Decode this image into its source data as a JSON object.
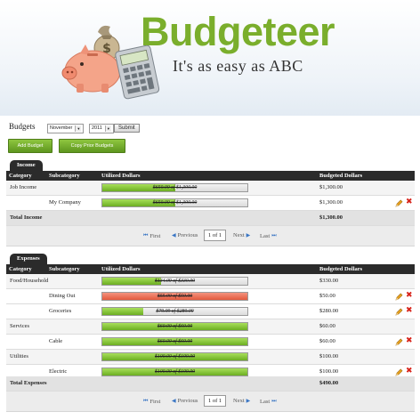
{
  "app": {
    "name": "Budgeteer",
    "tagline": "It's as easy as ABC"
  },
  "controls": {
    "label": "Budgets",
    "month": "November",
    "year": "2011",
    "submit_label": "Submit",
    "add_budget_label": "Add Budget",
    "copy_prior_label": "Copy Prior Budgets"
  },
  "columns": {
    "category": "Category",
    "subcategory": "Subcategory",
    "utilized": "Utilized Dollars",
    "budgeted": "Budgeted Dollars"
  },
  "income": {
    "tab_label": "Income",
    "rows": [
      {
        "category": "Job Income",
        "subcategory": "",
        "bar_text": "$650.00 of $1,300.00",
        "utilized_fraction": 0.5,
        "over": false,
        "budgeted": "$1,300.00",
        "editable": false
      },
      {
        "category": "",
        "subcategory": "My Company",
        "bar_text": "$650.00 of $1,300.00",
        "utilized_fraction": 0.5,
        "over": false,
        "budgeted": "$1,300.00",
        "editable": true
      }
    ],
    "total_label": "Total Income",
    "total_value": "$1,300.00"
  },
  "expenses": {
    "tab_label": "Expenses",
    "rows": [
      {
        "category": "Food/Household",
        "subcategory": "",
        "bar_text": "$134.09 of $330.00",
        "utilized_fraction": 0.406,
        "over": false,
        "budgeted": "$330.00",
        "editable": false
      },
      {
        "category": "",
        "subcategory": "Dining Out",
        "bar_text": "$55.00 of $50.00",
        "utilized_fraction": 1.0,
        "over": true,
        "budgeted": "$50.00",
        "editable": true
      },
      {
        "category": "",
        "subcategory": "Groceries",
        "bar_text": "$79.09 of $280.00",
        "utilized_fraction": 0.282,
        "over": false,
        "budgeted": "$280.00",
        "editable": true
      },
      {
        "category": "Services",
        "subcategory": "",
        "bar_text": "$60.00 of $60.00",
        "utilized_fraction": 1.0,
        "over": false,
        "budgeted": "$60.00",
        "editable": false
      },
      {
        "category": "",
        "subcategory": "Cable",
        "bar_text": "$60.00 of $60.00",
        "utilized_fraction": 1.0,
        "over": false,
        "budgeted": "$60.00",
        "editable": true
      },
      {
        "category": "Utilities",
        "subcategory": "",
        "bar_text": "$100.00 of $100.00",
        "utilized_fraction": 1.0,
        "over": false,
        "budgeted": "$100.00",
        "editable": false
      },
      {
        "category": "",
        "subcategory": "Electric",
        "bar_text": "$100.00 of $100.00",
        "utilized_fraction": 1.0,
        "over": false,
        "budgeted": "$100.00",
        "editable": true
      }
    ],
    "total_label": "Total Expenses",
    "total_value": "$490.00"
  },
  "pager": {
    "first": "First",
    "previous": "Previous",
    "page": "1 of 1",
    "next": "Next",
    "last": "Last"
  },
  "colors": {
    "brand": "#7aae2c",
    "bar_ok": "#6cae22",
    "bar_over": "#e35a3e",
    "delete": "#d7231a"
  }
}
